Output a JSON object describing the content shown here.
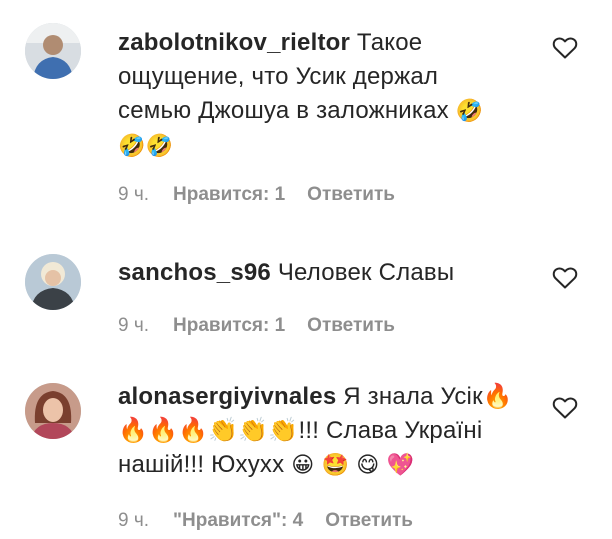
{
  "colors": {
    "text": "#262626",
    "meta": "#8e8e8e",
    "background": "#ffffff"
  },
  "comments": [
    {
      "username": "zabolotnikov_rieltor",
      "text": "Такое ощущение, что Усик держал семью Джошуа в заложниках",
      "emojis": "🤣 🤣🤣",
      "time": "9 ч.",
      "likes": "Нравится: 1",
      "reply": "Ответить",
      "like_icon": "heart-outline-icon"
    },
    {
      "username": "sanchos_s96",
      "text": "Человек Славы",
      "emojis": "",
      "time": "9 ч.",
      "likes": "Нравится: 1",
      "reply": "Ответить",
      "like_icon": "heart-outline-icon"
    },
    {
      "username": "alonasergiyivnales",
      "text": "Я знала Усік🔥 🔥🔥🔥👏👏👏!!! Слава Україні нашій!!! Юхуxx",
      "emojis": "😀 🤩 😋 💖",
      "time": "9 ч.",
      "likes": "\"Нравится\": 4",
      "reply": "Ответить",
      "like_icon": "heart-outline-icon"
    }
  ]
}
